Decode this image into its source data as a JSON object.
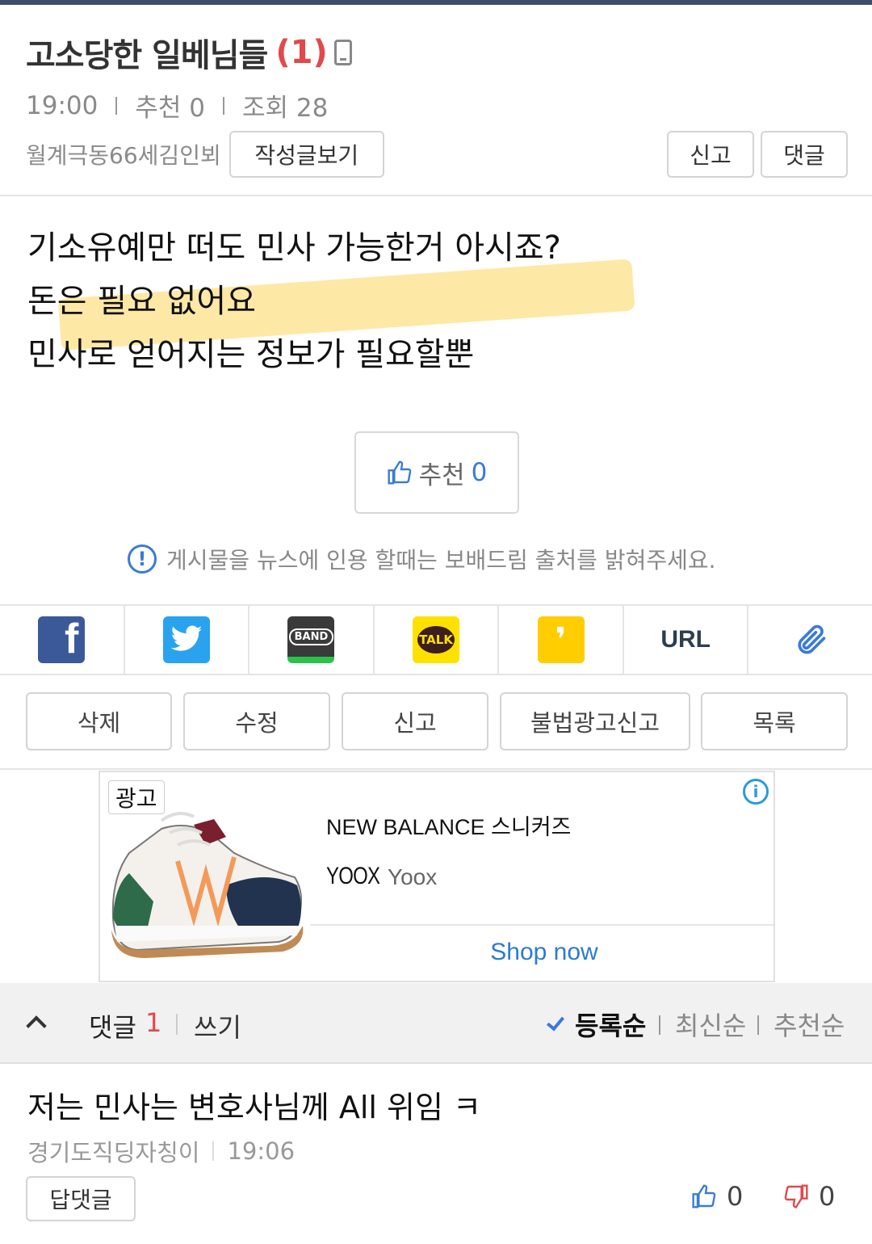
{
  "post": {
    "title": "고소당한 일베님들",
    "comment_count_label": "(1)",
    "time": "19:00",
    "recommend_meta": "추천 0",
    "views_meta": "조회 28",
    "author": "월계극동66세김인뵈",
    "view_posts_label": "작성글보기",
    "report_label": "신고",
    "comment_label": "댓글",
    "body_lines": [
      "기소유예만 떠도 민사 가능한거 아시죠?",
      "돈은 필요 없어요",
      "민사로 얻어지는 정보가 필요할뿐"
    ],
    "recommend_button_label": "추천",
    "recommend_count": "0",
    "notice": "게시물을 뉴스에 인용 할때는 보배드림 출처를 밝혀주세요."
  },
  "share": {
    "icons": [
      "facebook-icon",
      "twitter-icon",
      "band-icon",
      "kakaotalk-icon",
      "kakaostory-icon",
      "url-icon",
      "paperclip-icon"
    ],
    "band_text": "BAND",
    "talk_text": "TALK",
    "url_text": "URL"
  },
  "actions": {
    "delete": "삭제",
    "edit": "수정",
    "report": "신고",
    "illegal_ad_report": "불법광고신고",
    "list": "목록"
  },
  "ad": {
    "badge": "광고",
    "title": "NEW BALANCE 스니커즈",
    "logo_text": "YOOX",
    "brand": "Yoox",
    "cta": "Shop now",
    "info_symbol": "i"
  },
  "comments_bar": {
    "label": "댓글",
    "count": "1",
    "write": "쓰기",
    "sort_active": "등록순",
    "sort_latest": "최신순",
    "sort_recommend": "추천순"
  },
  "comments": [
    {
      "text": "저는 민사는 변호사님께 All 위임 ㅋ",
      "author": "경기도직딩자칭이",
      "time": "19:06",
      "reply_label": "답댓글",
      "likes": "0",
      "dislikes": "0"
    }
  ],
  "colors": {
    "accent_blue": "#3a7bd5",
    "count_red": "#e04a4a",
    "highlight_yellow": "#fdd65c"
  }
}
